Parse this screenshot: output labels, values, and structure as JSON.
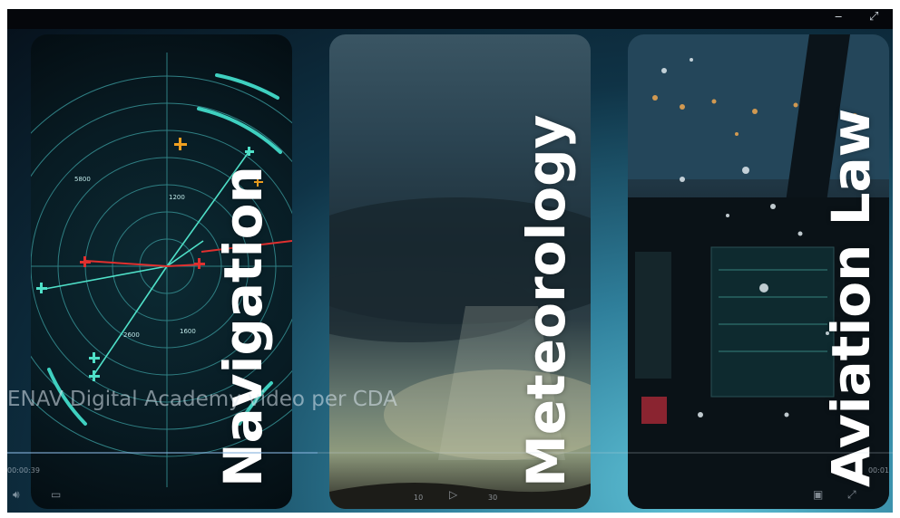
{
  "window": {
    "minimize_icon": "minimize-icon",
    "resize_icon": "resize-icon"
  },
  "cards": [
    {
      "title": "Navigation",
      "image": "radar-scope"
    },
    {
      "title": "Meteorology",
      "image": "storm-clouds"
    },
    {
      "title": "Aviation Law",
      "image": "cockpit-rain"
    }
  ],
  "radar_labels": [
    "5800",
    "1200",
    "2600",
    "1600"
  ],
  "player": {
    "title": "ENAV Digital Academy video per CDA",
    "time_elapsed": "00:00:39",
    "time_remaining": "00:01",
    "progress": 0.35,
    "skip_back_label": "10",
    "skip_forward_label": "30"
  },
  "colors": {
    "accent": "#3fd0c0",
    "radar_red": "#e0302f",
    "radar_orange": "#f0a020"
  }
}
